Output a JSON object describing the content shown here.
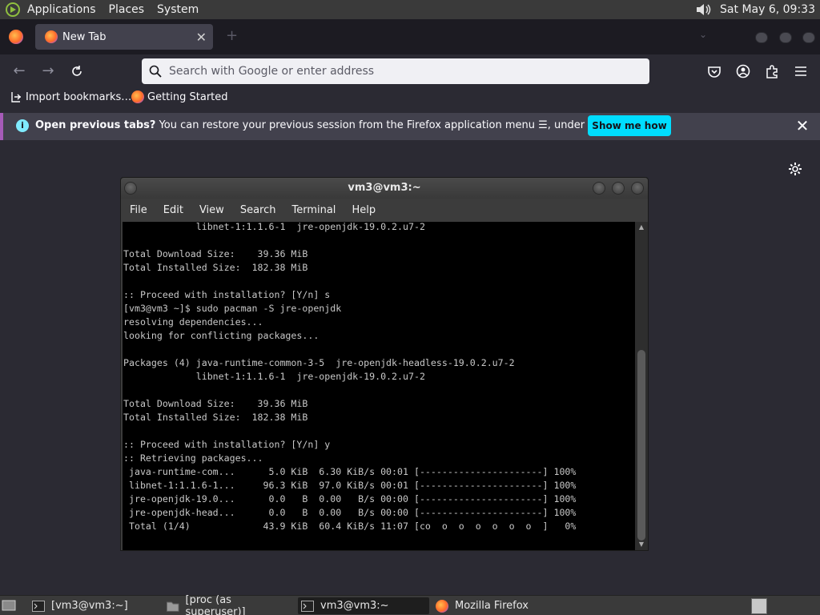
{
  "top_panel": {
    "menus": [
      "Applications",
      "Places",
      "System"
    ],
    "clock": "Sat May  6, 09:33"
  },
  "browser": {
    "tab_title": "New Tab",
    "url_placeholder": "Search with Google or enter address",
    "bookmarks": [
      "Import bookmarks…",
      "Getting Started"
    ],
    "notification": {
      "bold": "Open previous tabs?",
      "text": " You can restore your previous session from the Firefox application menu ☰, under History.",
      "button": "Show me how"
    },
    "accent_color": "#00ddff"
  },
  "terminal": {
    "title": "vm3@vm3:~",
    "menus": [
      "File",
      "Edit",
      "View",
      "Search",
      "Terminal",
      "Help"
    ],
    "lines": [
      "             libnet-1:1.1.6-1  jre-openjdk-19.0.2.u7-2",
      "",
      "Total Download Size:    39.36 MiB",
      "Total Installed Size:  182.38 MiB",
      "",
      ":: Proceed with installation? [Y/n] s",
      "[vm3@vm3 ~]$ sudo pacman -S jre-openjdk",
      "resolving dependencies...",
      "looking for conflicting packages...",
      "",
      "Packages (4) java-runtime-common-3-5  jre-openjdk-headless-19.0.2.u7-2",
      "             libnet-1:1.1.6-1  jre-openjdk-19.0.2.u7-2",
      "",
      "Total Download Size:    39.36 MiB",
      "Total Installed Size:  182.38 MiB",
      "",
      ":: Proceed with installation? [Y/n] y",
      ":: Retrieving packages...",
      " java-runtime-com...      5.0 KiB  6.30 KiB/s 00:01 [----------------------] 100%",
      " libnet-1:1.1.6-1...     96.3 KiB  97.0 KiB/s 00:01 [----------------------] 100%",
      " jre-openjdk-19.0...      0.0   B  0.00   B/s 00:00 [----------------------] 100%",
      " jre-openjdk-head...      0.0   B  0.00   B/s 00:00 [----------------------] 100%",
      " Total (1/4)             43.9 KiB  60.4 KiB/s 11:07 [co  o  o  o  o  o  o  ]   0%"
    ]
  },
  "taskbar": {
    "items": [
      "[vm3@vm3:~]",
      "[proc (as superuser)]",
      "vm3@vm3:~",
      "Mozilla Firefox"
    ]
  }
}
